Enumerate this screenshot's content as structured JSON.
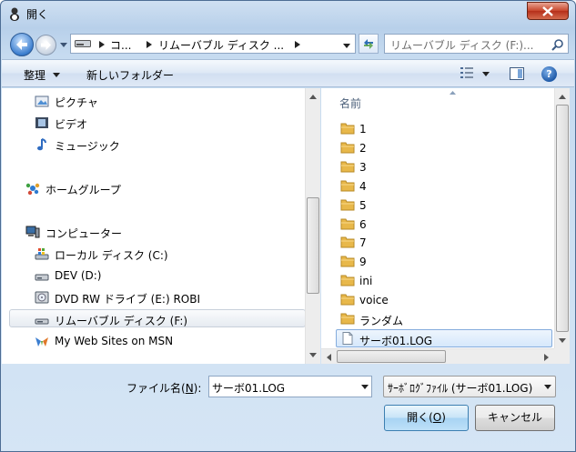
{
  "window": {
    "title": "開く"
  },
  "address": {
    "crumbs": [
      "コ...",
      "リムーバブル ディスク ..."
    ],
    "search_placeholder": "リムーバブル ディスク (F:)..."
  },
  "toolbar": {
    "organize": "整理",
    "new_folder": "新しいフォルダー"
  },
  "nav": {
    "items": [
      {
        "label": "ピクチャ",
        "icon": "pictures-icon"
      },
      {
        "label": "ビデオ",
        "icon": "video-icon"
      },
      {
        "label": "ミュージック",
        "icon": "music-icon"
      },
      {
        "label": "ホームグループ",
        "icon": "homegroup-icon"
      },
      {
        "label": "コンピューター",
        "icon": "computer-icon"
      },
      {
        "label": "ローカル ディスク (C:)",
        "icon": "local-disk-icon"
      },
      {
        "label": "DEV (D:)",
        "icon": "drive-icon"
      },
      {
        "label": "DVD RW ドライブ (E:) ROBI",
        "icon": "dvd-drive-icon"
      },
      {
        "label": "リムーバブル ディスク (F:)",
        "icon": "removable-disk-icon"
      },
      {
        "label": "My Web Sites on MSN",
        "icon": "msn-icon"
      }
    ]
  },
  "files": {
    "column_name": "名前",
    "items": [
      {
        "label": "1",
        "type": "folder"
      },
      {
        "label": "2",
        "type": "folder"
      },
      {
        "label": "3",
        "type": "folder"
      },
      {
        "label": "4",
        "type": "folder"
      },
      {
        "label": "5",
        "type": "folder"
      },
      {
        "label": "6",
        "type": "folder"
      },
      {
        "label": "7",
        "type": "folder"
      },
      {
        "label": "9",
        "type": "folder"
      },
      {
        "label": "ini",
        "type": "folder"
      },
      {
        "label": "voice",
        "type": "folder"
      },
      {
        "label": "ランダム",
        "type": "folder"
      },
      {
        "label": "サーボ01.LOG",
        "type": "file"
      }
    ]
  },
  "bottom": {
    "filename_label_pre": "ファイル名(",
    "filename_label_key": "N",
    "filename_label_post": "):",
    "filename_value": "サーボ01.LOG",
    "filetype_value": "ｻｰﾎﾞﾛｸﾞﾌｧｲﾙ (サーボ01.LOG)",
    "open_pre": "開く(",
    "open_key": "O",
    "open_post": ")",
    "cancel": "キャンセル"
  },
  "colors": {
    "folder": "#e8b84a",
    "selection_border": "#84acdd",
    "accent": "#3c7fb1"
  }
}
